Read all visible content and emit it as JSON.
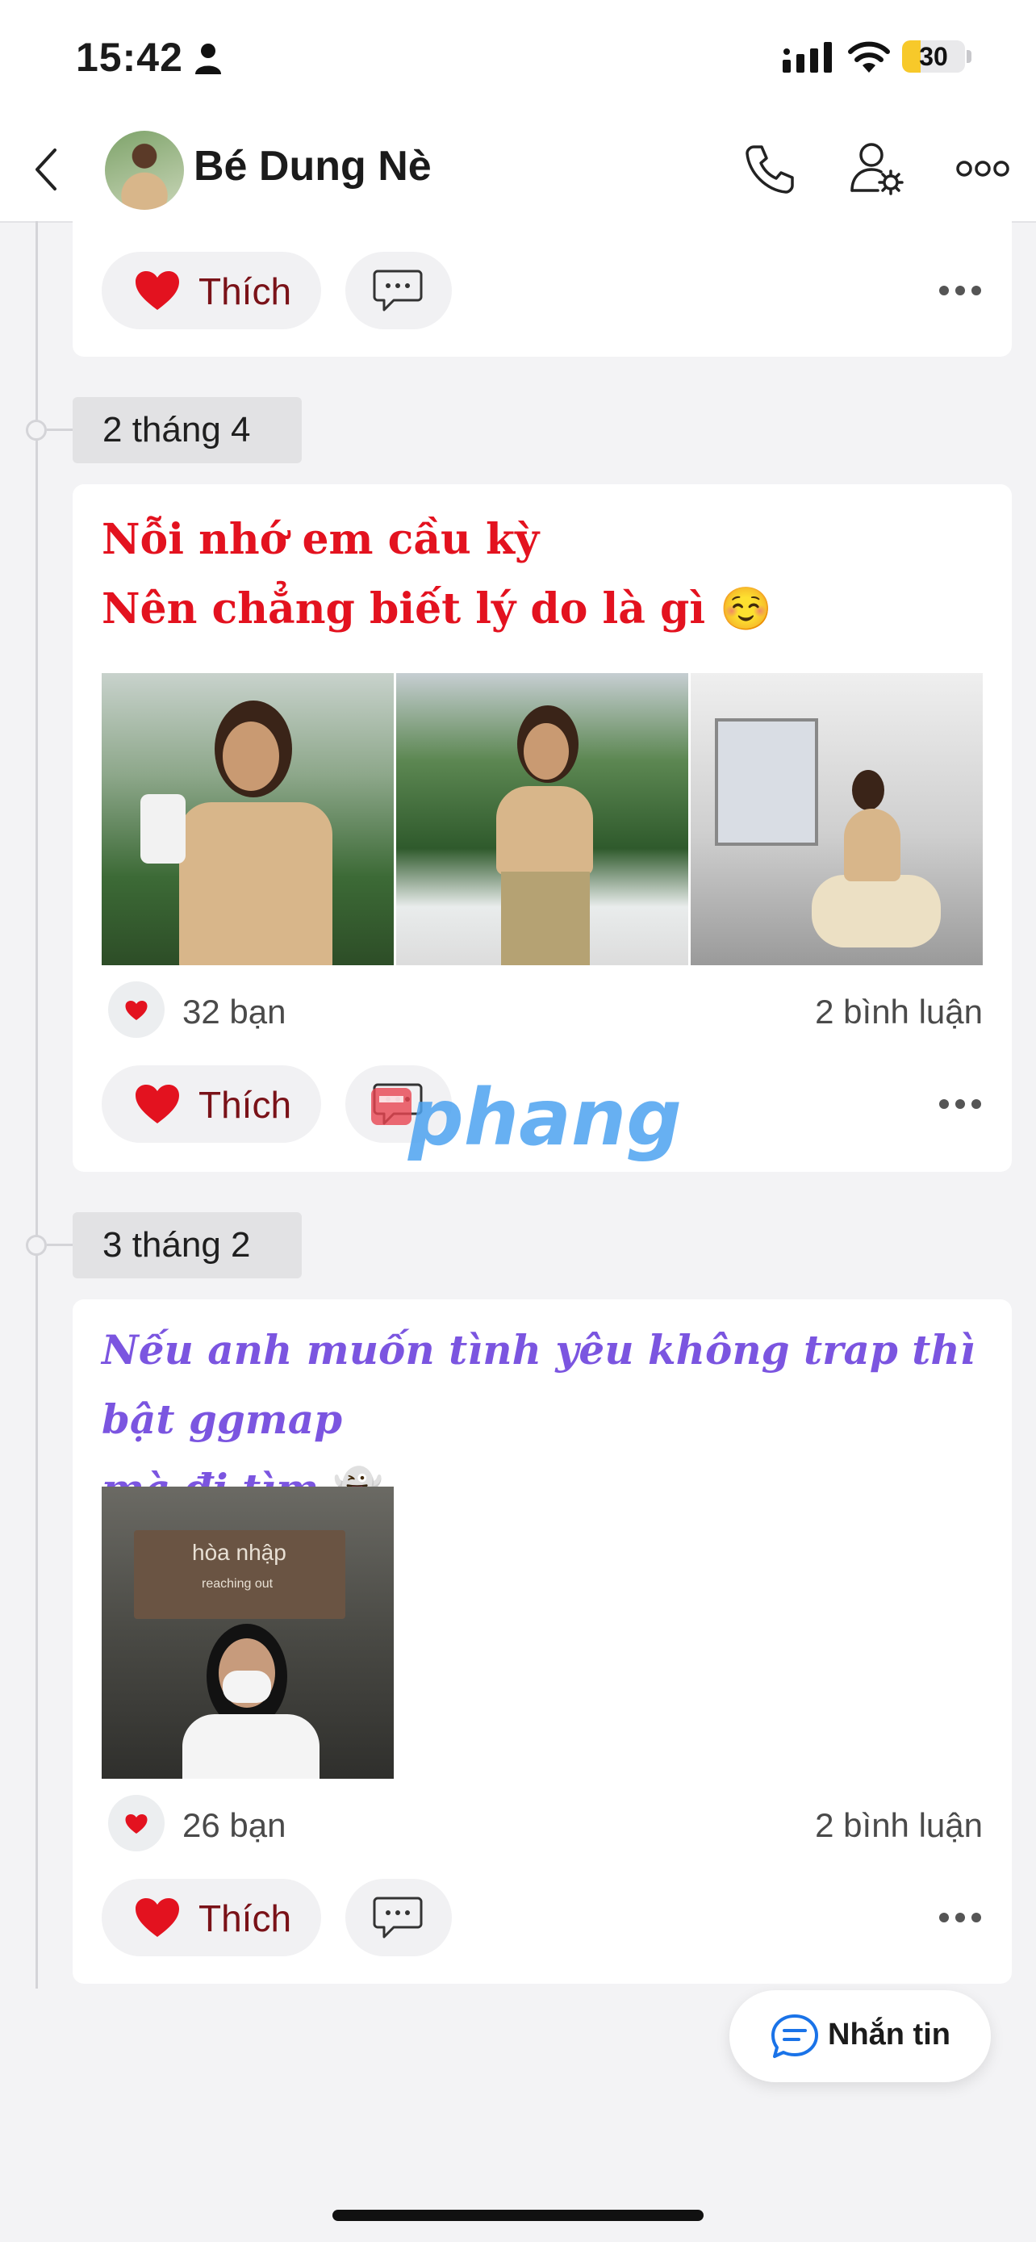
{
  "status_bar": {
    "time": "15:42",
    "battery": "30",
    "battery_level": 0.3,
    "icons": [
      "person-icon",
      "signal-icon",
      "wifi-icon",
      "battery-icon"
    ]
  },
  "header": {
    "title": "Bé Dung Nè",
    "icons": [
      "back-icon",
      "phone-icon",
      "profile-settings-icon",
      "more-icon"
    ]
  },
  "actions": {
    "like_label": "Thích",
    "heart_color": "#e3121f"
  },
  "posts": [
    {
      "date": "2 tháng 4",
      "text_line1": "Nỗi nhớ em cầu kỳ",
      "text_line2": "Nên chẳng biết lý do là gì",
      "text_emoji": "☺️",
      "text_color": "#e3121f",
      "photo_count": 3,
      "likes": "32 bạn",
      "comments": "2 bình luận"
    },
    {
      "date": "3 tháng 2",
      "text_line1": "Nếu anh muốn tình yêu không trap thì bật ggmap",
      "text_line2": "mà đi tìm",
      "text_emoji": "👻",
      "text_color": "#7b55e0",
      "photo_count": 1,
      "photo_sign": "hòa nhập",
      "photo_sign_sub": "reaching out",
      "likes": "26 bạn",
      "comments": "2 bình luận"
    }
  ],
  "watermark": "phang",
  "chat_button": {
    "label": "Nhắn tin"
  }
}
